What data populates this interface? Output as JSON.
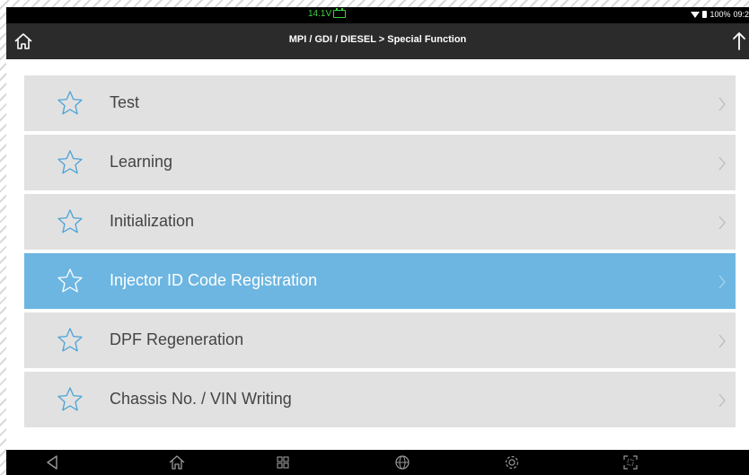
{
  "status_bar": {
    "voltage": "14.1V",
    "battery_percent": "100%",
    "time": "09:2"
  },
  "title_bar": {
    "breadcrumb": "MPI / GDI / DIESEL > Special Function"
  },
  "menu": {
    "items": [
      {
        "label": "Test",
        "selected": false
      },
      {
        "label": "Learning",
        "selected": false
      },
      {
        "label": "Initialization",
        "selected": false
      },
      {
        "label": "Injector ID Code Registration",
        "selected": true
      },
      {
        "label": "DPF Regeneration",
        "selected": false
      },
      {
        "label": "Chassis No. / VIN Writing",
        "selected": false
      }
    ]
  },
  "colors": {
    "selected_row": "#6cb6e1",
    "row": "#e1e1e1",
    "star": "#4aa3d6",
    "title_bar": "#2b2b2b",
    "voltage_text": "#3fd23f"
  },
  "nav_bar": {
    "icons": [
      "back-icon",
      "home-icon",
      "apps-icon",
      "globe-icon",
      "settings-icon",
      "screenshot-icon"
    ]
  }
}
